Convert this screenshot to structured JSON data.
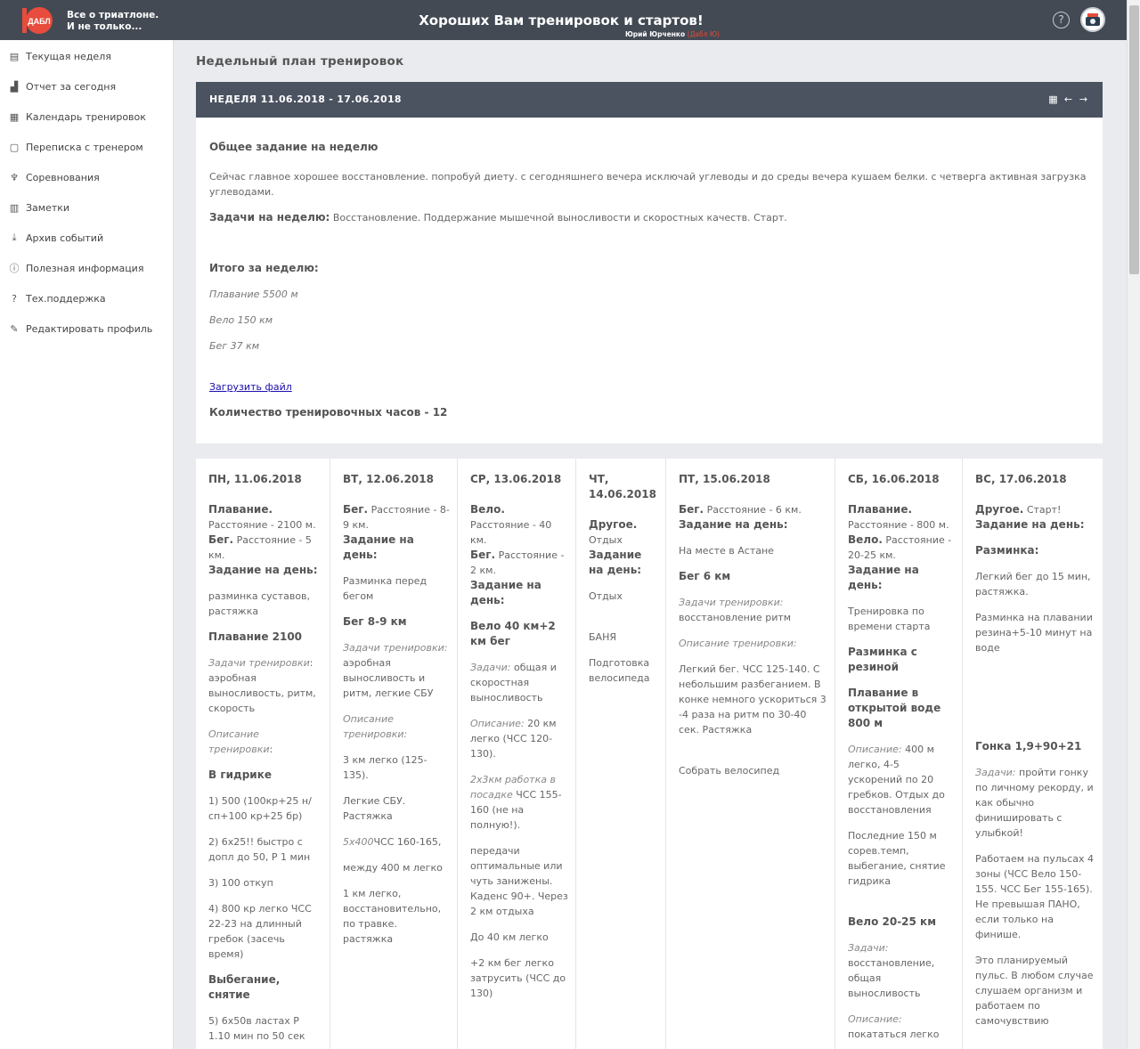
{
  "header": {
    "brand_line1": "Все о триатлоне.",
    "brand_line2": "И не только...",
    "logo_text": "ДАБЛ",
    "tagline": "Хороших Вам тренировок и стартов!",
    "user_name": "Юрий Юрченко",
    "user_nick": "(Дабл Ю)",
    "help_glyph": "?"
  },
  "sidebar": {
    "items": [
      {
        "label": "Текущая неделя",
        "icon": "calendar-week-icon"
      },
      {
        "label": "Отчет за сегодня",
        "icon": "bar-chart-icon"
      },
      {
        "label": "Календарь тренировок",
        "icon": "calendar-icon"
      },
      {
        "label": "Переписка с тренером",
        "icon": "chat-icon"
      },
      {
        "label": "Соревнования",
        "icon": "trophy-icon"
      },
      {
        "label": "Заметки",
        "icon": "notes-icon"
      },
      {
        "label": "Архив событий",
        "icon": "archive-icon"
      },
      {
        "label": "Полезная информация",
        "icon": "info-icon"
      },
      {
        "label": "Тех.поддержка",
        "icon": "help-icon"
      },
      {
        "label": "Редактировать профиль",
        "icon": "edit-profile-icon"
      }
    ]
  },
  "main": {
    "page_title": "Недельный план тренировок",
    "week_label": "НЕДЕЛЯ 11.06.2018 - 17.06.2018",
    "general_title": "Общее задание на неделю",
    "general_text": "Сейчас главное хорошее восстановление. попробуй диету. с сегодняшнего вечера исключай углеводы и до среды вечера кушаем белки. с четверга активная загрузка углеводами.",
    "tasks_label": "Задачи на неделю:",
    "tasks_text": " Восстановление. Поддержание мышечной выносливости и скоростных качеств. Старт.",
    "total_title": "Итого за неделю:",
    "total_swim": "Плавание  5500 м",
    "total_bike": "Вело 150 км",
    "total_run": "Бег 37  км",
    "upload_link": "Загрузить файл",
    "hours": "Количество тренировочных часов - 12"
  },
  "days": [
    {
      "title": "ПН, 11.06.2018"
    },
    {
      "title": "ВТ, 12.06.2018"
    },
    {
      "title": "СР, 13.06.2018"
    },
    {
      "title": "ЧТ, 14.06.2018"
    },
    {
      "title": "ПТ, 15.06.2018"
    },
    {
      "title": "СБ, 16.06.2018"
    },
    {
      "title": "ВС, 17.06.2018"
    }
  ],
  "texts": {
    "mon": [
      "Плавание.",
      "Расстояние - 2100 м.",
      "Бег.",
      "Расстояние - 5 км.",
      "Задание на день:",
      "разминка суставов, растяжка",
      "Плавание  2100",
      "Задачи тренировки",
      "аэробная выносливость, ритм, скорость",
      "Описание тренировки",
      ":",
      "В гидрике",
      "1) 500 (100кр+25 н/сп+100 кр+25 бр)",
      "2) 6х25!! быстро с допл до 50,  Р 1 мин",
      "3) 100 откуп",
      "4) 800 кр легко ЧСС 22-23 на длинный гребок (засечь время)",
      "Выбегание, снятие",
      "5) 6х50в ластах  Р 1.10 мин по 50 сек"
    ],
    "tue": [
      "Бег.",
      "Расстояние - 8-9 км.",
      "Задание на день:",
      "Разминка перед бегом",
      "Бег 8-9 км",
      "Задачи тренировки:",
      "аэробная выносливость и ритм, легкие СБУ",
      "Описание тренировки:",
      "3 км легко (125-135).",
      "Легкие СБУ. Растяжка",
      "5х400",
      "ЧСС 160-165,",
      "между 400 м легко",
      "1 км легко, восстановительно, по травке.  растяжка"
    ],
    "wed": [
      "Вело.",
      "Расстояние - 40 км.",
      "Бег.",
      "Расстояние - 2 км.",
      "Задание на день:",
      "Вело 40 км+2 км бег",
      "Задачи:",
      "общая и скоростная выносливость",
      "Описание:",
      "20 км легко (ЧСС 120-130).",
      "2х3км работка в посадке",
      "ЧСС 155-160 (не на полную!).",
      "передачи оптимальные  или чуть занижены. Каденс 90+. Через 2 км отдыха",
      "До 40 км легко",
      "+2 км бег легко затрусить (ЧСС до 130)"
    ],
    "thu": [
      "Другое.",
      "Отдых",
      "Задание на день:",
      "Отдых",
      "БАНЯ",
      "Подготовка велосипеда"
    ],
    "fri": [
      "Бег.",
      "Расстояние - 6 км.",
      "Задание на день:",
      "На месте в Астане",
      "Бег 6 км",
      "Задачи тренировки:",
      "восстановление ритм",
      "Описание тренировки:",
      "Легкий бег. ЧСС 125-140. С небольшим разбеганием. В конке немного ускориться 3 -4 раза на ритм по 30-40 сек. Растяжка",
      "Собрать велосипед"
    ],
    "sat": [
      "Плавание.",
      "Расстояние - 800 м.",
      "Вело.",
      "Расстояние - 20-25 км.",
      "Задание на день:",
      "Тренировка по времени старта",
      "Разминка с резиной",
      "Плавание в открытой воде 800 м",
      "Описание:",
      "400 м легко, 4-5 ускорений по 20 гребков. Отдых до восстановления",
      "Последние 150 м сорев.темп, выбегание, снятие гидрика",
      "Вело 20-25 км",
      "Задачи:",
      "восстановление, общая  выносливость",
      "Описание:",
      "покататься легко"
    ],
    "sun": [
      "Другое.",
      "Старт!",
      "Задание на день:",
      "Разминка:",
      "Легкий бег до 15 мин, растяжка.",
      "Разминка на плавании резина+5-10 минут на воде",
      "Гонка 1,9+90+21",
      "Задачи:",
      "пройти гонку по личному рекорду, и как обычно финишировать с улыбкой!",
      "Работаем на пульсах 4 зоны (ЧСС Вело 150-155. ЧСС Бег 155-165). Не превышая ПАНО, если только на финише.",
      "Это планируемый пульс. В любом случае слушаем организм и работаем по самочувствию"
    ]
  }
}
